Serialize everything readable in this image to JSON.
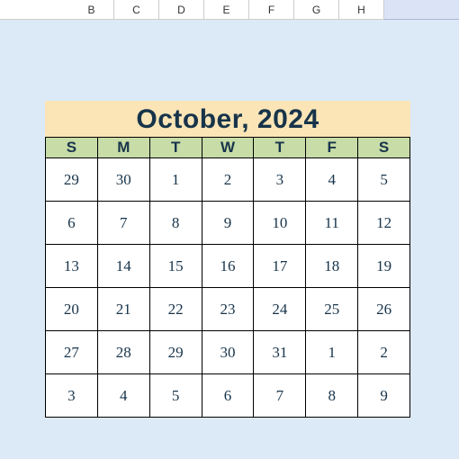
{
  "columns": [
    "B",
    "C",
    "D",
    "E",
    "F",
    "G",
    "H"
  ],
  "calendar": {
    "title": "October, 2024",
    "day_labels": [
      "S",
      "M",
      "T",
      "W",
      "T",
      "F",
      "S"
    ],
    "weeks": [
      [
        "29",
        "30",
        "1",
        "2",
        "3",
        "4",
        "5"
      ],
      [
        "6",
        "7",
        "8",
        "9",
        "10",
        "11",
        "12"
      ],
      [
        "13",
        "14",
        "15",
        "16",
        "17",
        "18",
        "19"
      ],
      [
        "20",
        "21",
        "22",
        "23",
        "24",
        "25",
        "26"
      ],
      [
        "27",
        "28",
        "29",
        "30",
        "31",
        "1",
        "2"
      ],
      [
        "3",
        "4",
        "5",
        "6",
        "7",
        "8",
        "9"
      ]
    ]
  },
  "colors": {
    "sheet_bg": "#dceaf7",
    "title_bg": "#fbe5b6",
    "head_bg": "#c7dca7"
  }
}
